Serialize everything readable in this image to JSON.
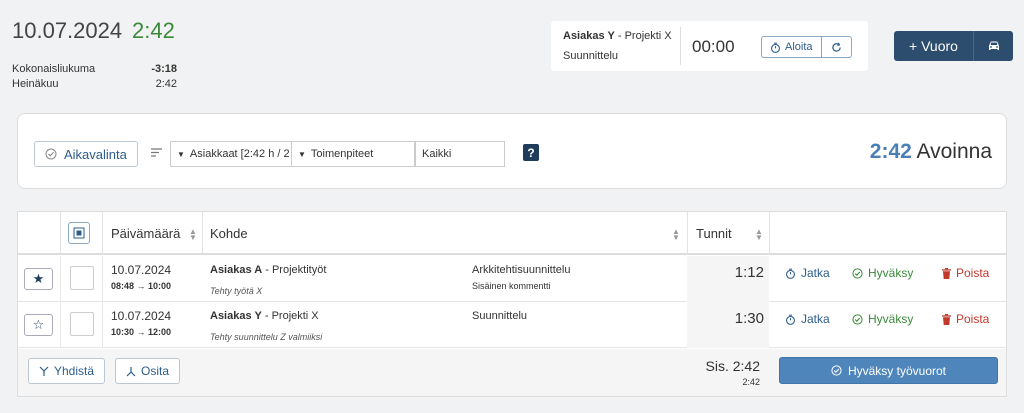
{
  "header": {
    "date": "10.07.2024",
    "time": "2:42",
    "summary": [
      {
        "label": "Kokonaisliukuma",
        "value": "-3:18"
      },
      {
        "label": "Heinäkuu",
        "value": "2:42"
      }
    ]
  },
  "timer": {
    "client": "Asiakas Y",
    "project": " - Projekti X",
    "task": "Suunnittelu",
    "value": "00:00",
    "start_label": "Aloita"
  },
  "vuoro_button": {
    "label": "+ Vuoro"
  },
  "filters": {
    "aikavalinta_label": "Aikavalinta",
    "customers": "Asiakkaat [2:42 h / 2",
    "actions": "Toimenpiteet",
    "all": "Kaikki",
    "open_total": "2:42",
    "open_label": "Avoinna"
  },
  "table": {
    "columns": {
      "date": "Päivämäärä",
      "target": "Kohde",
      "hours": "Tunnit"
    },
    "rows": [
      {
        "starred": true,
        "date": "10.07.2024",
        "time": "08:48 → 10:00",
        "client": "Asiakas A",
        "project": " - Projektityöt",
        "note": "Tehty työtä X",
        "task": "Arkkitehtisuunnittelu",
        "comment": "Sisäinen kommentti",
        "hours": "1:12"
      },
      {
        "starred": false,
        "date": "10.07.2024",
        "time": "10:30 → 12:00",
        "client": "Asiakas Y",
        "project": " - Projekti X",
        "note": "Tehty suunnittelu Z valmiiksi",
        "task": "Suunnittelu",
        "comment": "",
        "hours": "1:30"
      }
    ],
    "actions": {
      "continue": "Jatka",
      "approve": "Hyväksy",
      "delete": "Poista"
    },
    "footer": {
      "merge": "Yhdistä",
      "split": "Osita",
      "total": "Sis. 2:42",
      "total_small": "2:42",
      "approve_shifts": "Hyväksy työvuorot"
    }
  },
  "colors": {
    "accent": "#2c4d6e",
    "green": "#3b8a3b",
    "red": "#c0392b",
    "link": "#2d5d8c",
    "primary_button": "#4e86bb"
  }
}
